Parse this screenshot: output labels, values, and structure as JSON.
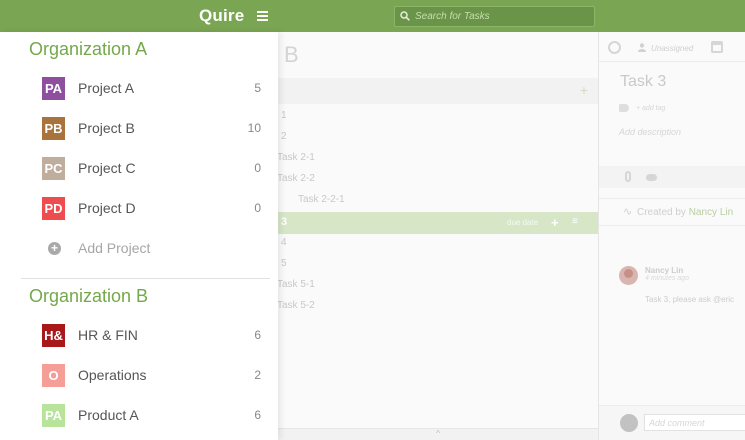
{
  "topbar": {
    "logo": "Quire",
    "search_placeholder": "Search for Tasks"
  },
  "main": {
    "title": "B",
    "tasks": [
      {
        "name": "1",
        "selected": false
      },
      {
        "name": "2",
        "selected": false
      },
      {
        "name": "Task 2-1",
        "selected": false
      },
      {
        "name": "Task 2-2",
        "selected": false
      },
      {
        "name": "Task 2-2-1",
        "selected": false
      },
      {
        "name": "3",
        "selected": true,
        "due_label": "due date"
      },
      {
        "name": "4",
        "selected": false
      },
      {
        "name": "5",
        "selected": false
      },
      {
        "name": "Task 5-1",
        "selected": false
      },
      {
        "name": "Task 5-2",
        "selected": false
      }
    ],
    "footer_caret": "^"
  },
  "detail": {
    "assignee": "Unassigned",
    "task_title": "Task 3",
    "add_tag": "+ add tag",
    "add_description": "Add description",
    "created_by_prefix": "Created by",
    "created_by_name": "Nancy Lin",
    "comment": {
      "author": "Nancy Lin",
      "time": "4 minutes ago",
      "text": "Task 3, please ask @eric"
    },
    "comment_placeholder": "Add comment"
  },
  "sidebar": {
    "organizations": [
      {
        "name": "Organization A",
        "projects": [
          {
            "initials": "PA",
            "name": "Project A",
            "count": "5",
            "color": "#8e4f9e"
          },
          {
            "initials": "PB",
            "name": "Project B",
            "count": "10",
            "color": "#a8743c"
          },
          {
            "initials": "PC",
            "name": "Project C",
            "count": "0",
            "color": "#bfae9e"
          },
          {
            "initials": "PD",
            "name": "Project D",
            "count": "0",
            "color": "#ee4c4f"
          }
        ],
        "add_project_label": "Add Project"
      },
      {
        "name": "Organization B",
        "projects": [
          {
            "initials": "H&",
            "name": "HR & FIN",
            "count": "6",
            "color": "#a8171a"
          },
          {
            "initials": "O",
            "name": "Operations",
            "count": "2",
            "color": "#f59d97"
          },
          {
            "initials": "PA",
            "name": "Product A",
            "count": "6",
            "color": "#b8e39a"
          }
        ]
      }
    ]
  },
  "colors": {
    "topbar": "#7aa552",
    "accent_green": "#74a84a",
    "selected_row": "#d8e6c8"
  }
}
